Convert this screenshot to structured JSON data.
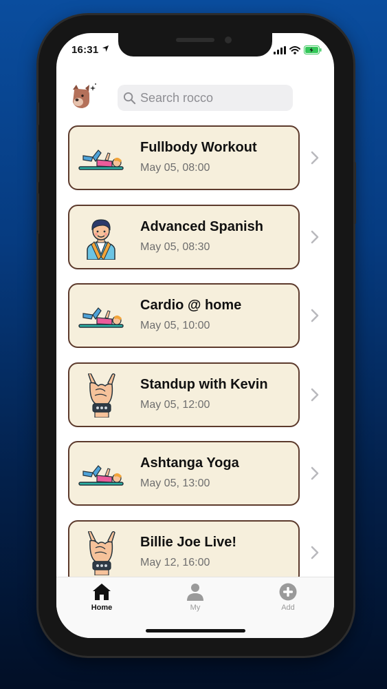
{
  "status_bar": {
    "time": "16:31",
    "location_icon": "location-arrow-icon",
    "battery_color": "#34c759"
  },
  "search": {
    "placeholder": "Search rocco"
  },
  "events": [
    {
      "title": "Fullbody Workout",
      "datetime": "May 05, 08:00",
      "icon": "exercise-icon"
    },
    {
      "title": "Advanced Spanish",
      "datetime": "May 05, 08:30",
      "icon": "teacher-icon"
    },
    {
      "title": "Cardio @ home",
      "datetime": "May 05, 10:00",
      "icon": "exercise-icon"
    },
    {
      "title": "Standup with Kevin",
      "datetime": "May 05, 12:00",
      "icon": "rock-hand-icon"
    },
    {
      "title": "Ashtanga Yoga",
      "datetime": "May 05, 13:00",
      "icon": "exercise-icon"
    },
    {
      "title": "Billie Joe Live!",
      "datetime": "May 12, 16:00",
      "icon": "rock-hand-icon"
    }
  ],
  "tabs": [
    {
      "label": "Home",
      "icon": "home-icon",
      "active": true
    },
    {
      "label": "My",
      "icon": "person-icon",
      "active": false
    },
    {
      "label": "Add",
      "icon": "plus-circle-icon",
      "active": false
    }
  ],
  "colors": {
    "card_bg": "#f6efdc",
    "card_border": "#5c3a2c",
    "tab_active": "#111111",
    "tab_inactive": "#9a9a9a"
  }
}
